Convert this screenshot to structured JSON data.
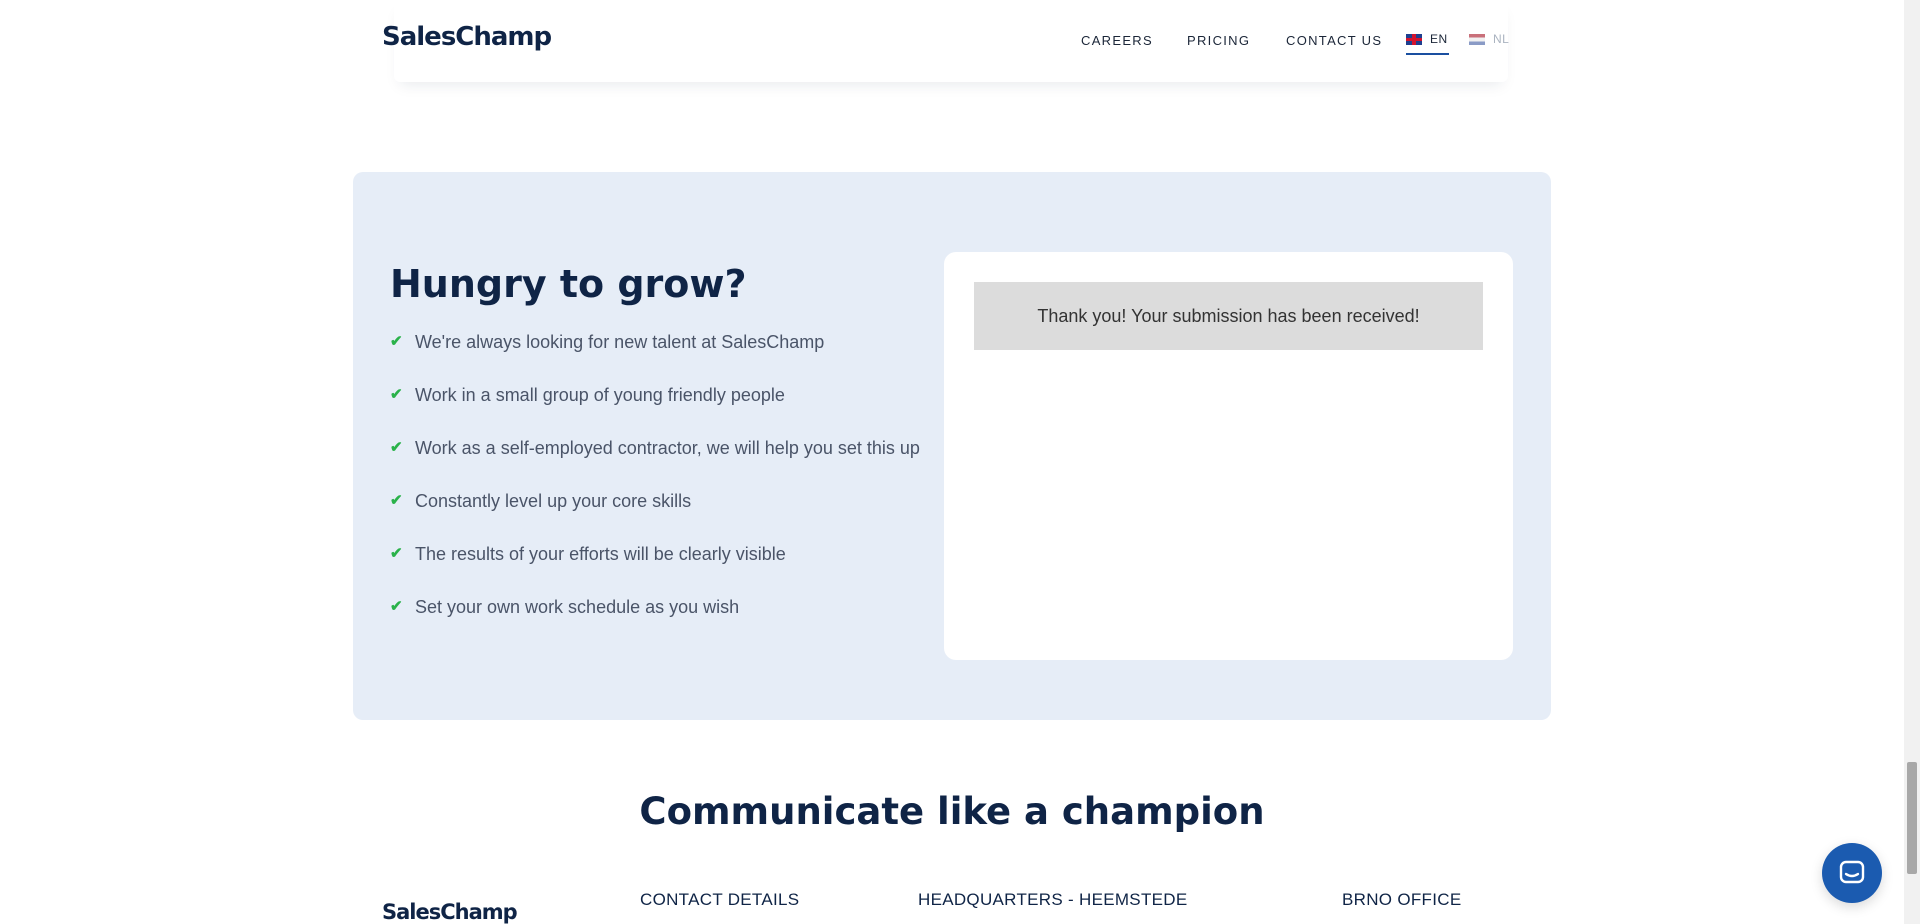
{
  "header": {
    "logo": "SalesChamp",
    "nav": [
      {
        "label": "CAREERS"
      },
      {
        "label": "PRICING"
      },
      {
        "label": "CONTACT US"
      }
    ],
    "languages": [
      {
        "code": "EN",
        "active": true,
        "icon": "uk-flag-icon"
      },
      {
        "code": "NL",
        "active": false,
        "icon": "nl-flag-icon"
      }
    ]
  },
  "careers": {
    "title": "Hungry to grow?",
    "perks": [
      "We're always looking for new talent at SalesChamp",
      "Work in a small group of young friendly people",
      "Work as a self-employed contractor, we will help you set this up",
      "Constantly level up your core skills",
      "The results of your efforts will be clearly visible",
      "Set your own work schedule as you wish"
    ],
    "success_message": "Thank you! Your submission has been received!"
  },
  "footer": {
    "tagline": "Communicate like a champion",
    "logo": "SalesChamp",
    "columns": [
      "CONTACT DETAILS",
      "HEADQUARTERS - HEEMSTEDE",
      "BRNO OFFICE"
    ]
  },
  "colors": {
    "brand_navy": "#0f2446",
    "card_bg": "#e6edf7",
    "check_green": "#2ab24a",
    "chat_blue": "#1b5bb0"
  }
}
